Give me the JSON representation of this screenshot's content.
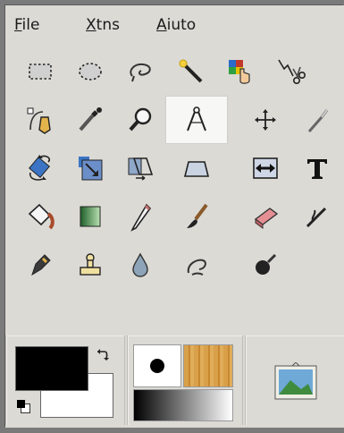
{
  "menubar": {
    "file": {
      "u": "F",
      "rest": "ile"
    },
    "xtns": {
      "u": "X",
      "rest": "tns"
    },
    "aiuto": {
      "u": "A",
      "rest": "iuto"
    }
  },
  "tools": [
    {
      "name": "rect-select-icon",
      "active": false
    },
    {
      "name": "ellipse-select-icon",
      "active": false
    },
    {
      "name": "free-select-icon",
      "active": false
    },
    {
      "name": "fuzzy-select-icon",
      "active": false
    },
    {
      "name": "select-by-color-icon",
      "active": false
    },
    {
      "name": "scissors-select-icon",
      "active": false
    },
    {
      "name": "paths-icon",
      "active": false
    },
    {
      "name": "color-picker-icon",
      "active": false
    },
    {
      "name": "zoom-icon",
      "active": false
    },
    {
      "name": "measure-icon",
      "active": true
    },
    {
      "name": "move-icon",
      "active": false
    },
    {
      "name": "crop-icon",
      "active": false
    },
    {
      "name": "rotate-icon",
      "active": false
    },
    {
      "name": "scale-icon",
      "active": false
    },
    {
      "name": "shear-icon",
      "active": false
    },
    {
      "name": "perspective-icon",
      "active": false
    },
    {
      "name": "flip-icon",
      "active": false
    },
    {
      "name": "text-icon",
      "active": false
    },
    {
      "name": "bucket-fill-icon",
      "active": false
    },
    {
      "name": "blend-icon",
      "active": false
    },
    {
      "name": "pencil-icon",
      "active": false
    },
    {
      "name": "paintbrush-icon",
      "active": false
    },
    {
      "name": "eraser-icon",
      "active": false
    },
    {
      "name": "airbrush-icon",
      "active": false
    },
    {
      "name": "ink-icon",
      "active": false
    },
    {
      "name": "clone-icon",
      "active": false
    },
    {
      "name": "blur-icon",
      "active": false
    },
    {
      "name": "smudge-icon",
      "active": false
    },
    {
      "name": "dodge-burn-icon",
      "active": false
    }
  ],
  "colors": {
    "foreground": "#000000",
    "background": "#ffffff",
    "brush_preview": "#000000",
    "pattern": "#d69a3c"
  }
}
